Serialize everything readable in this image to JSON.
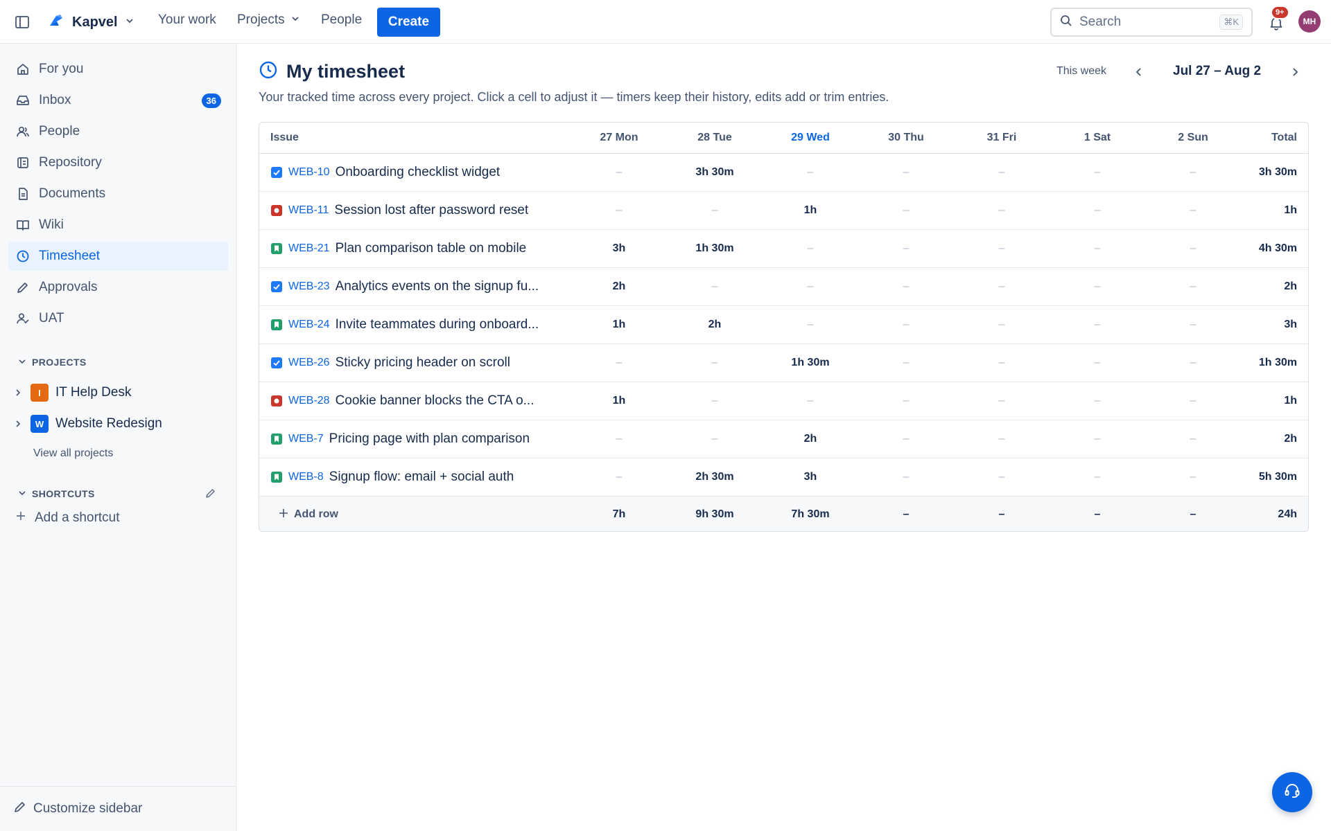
{
  "topbar": {
    "brand_name": "Kapvel",
    "nav_your_work": "Your work",
    "nav_projects": "Projects",
    "nav_people": "People",
    "create_label": "Create",
    "search_placeholder": "Search",
    "search_shortcut": "⌘K",
    "notif_badge": "9+",
    "avatar_initials": "MH"
  },
  "sidebar": {
    "items": [
      {
        "label": "For you",
        "icon": "home-icon"
      },
      {
        "label": "Inbox",
        "icon": "inbox-icon",
        "badge": "36"
      },
      {
        "label": "People",
        "icon": "people-icon"
      },
      {
        "label": "Repository",
        "icon": "repository-icon"
      },
      {
        "label": "Documents",
        "icon": "document-icon"
      },
      {
        "label": "Wiki",
        "icon": "book-icon"
      },
      {
        "label": "Timesheet",
        "icon": "clock-icon",
        "active": true
      },
      {
        "label": "Approvals",
        "icon": "pen-icon"
      },
      {
        "label": "UAT",
        "icon": "user-check-icon"
      }
    ],
    "projects_heading": "PROJECTS",
    "projects": [
      {
        "name": "IT Help Desk",
        "letter": "I",
        "color": "#e56910"
      },
      {
        "name": "Website Redesign",
        "letter": "W",
        "color": "#0c66e4"
      }
    ],
    "view_all": "View all projects",
    "shortcuts_heading": "SHORTCUTS",
    "add_shortcut": "Add a shortcut",
    "customize": "Customize sidebar"
  },
  "page": {
    "title": "My timesheet",
    "subtitle": "Your tracked time across every project. Click a cell to adjust it — timers keep their history, edits add or trim entries.",
    "week_label": "This week",
    "week_range": "Jul 27 – Aug 2"
  },
  "table": {
    "headers": {
      "issue": "Issue",
      "days": [
        "27 Mon",
        "28 Tue",
        "29 Wed",
        "30 Thu",
        "31 Fri",
        "1 Sat",
        "2 Sun"
      ],
      "total": "Total"
    },
    "today_index": 2,
    "rows": [
      {
        "key": "WEB-10",
        "type": "task",
        "summary": "Onboarding checklist widget",
        "cells": [
          "–",
          "3h 30m",
          "–",
          "–",
          "–",
          "–",
          "–"
        ],
        "total": "3h 30m"
      },
      {
        "key": "WEB-11",
        "type": "bug",
        "summary": "Session lost after password reset",
        "cells": [
          "–",
          "–",
          "1h",
          "–",
          "–",
          "–",
          "–"
        ],
        "total": "1h"
      },
      {
        "key": "WEB-21",
        "type": "story",
        "summary": "Plan comparison table on mobile",
        "cells": [
          "3h",
          "1h 30m",
          "–",
          "–",
          "–",
          "–",
          "–"
        ],
        "total": "4h 30m"
      },
      {
        "key": "WEB-23",
        "type": "task",
        "summary": "Analytics events on the signup fu...",
        "cells": [
          "2h",
          "–",
          "–",
          "–",
          "–",
          "–",
          "–"
        ],
        "total": "2h"
      },
      {
        "key": "WEB-24",
        "type": "story",
        "summary": "Invite teammates during onboard...",
        "cells": [
          "1h",
          "2h",
          "–",
          "–",
          "–",
          "–",
          "–"
        ],
        "total": "3h"
      },
      {
        "key": "WEB-26",
        "type": "task",
        "summary": "Sticky pricing header on scroll",
        "cells": [
          "–",
          "–",
          "1h 30m",
          "–",
          "–",
          "–",
          "–"
        ],
        "total": "1h 30m"
      },
      {
        "key": "WEB-28",
        "type": "bug",
        "summary": "Cookie banner blocks the CTA o...",
        "cells": [
          "1h",
          "–",
          "–",
          "–",
          "–",
          "–",
          "–"
        ],
        "total": "1h"
      },
      {
        "key": "WEB-7",
        "type": "story",
        "summary": "Pricing page with plan comparison",
        "cells": [
          "–",
          "–",
          "2h",
          "–",
          "–",
          "–",
          "–"
        ],
        "total": "2h"
      },
      {
        "key": "WEB-8",
        "type": "story",
        "summary": "Signup flow: email + social auth",
        "cells": [
          "–",
          "2h 30m",
          "3h",
          "–",
          "–",
          "–",
          "–"
        ],
        "total": "5h 30m"
      }
    ],
    "footer": {
      "add_row": "Add row",
      "totals": [
        "7h",
        "9h 30m",
        "7h 30m",
        "–",
        "–",
        "–",
        "–"
      ],
      "grand_total": "24h"
    }
  },
  "colors": {
    "accent": "#0c66e4",
    "task": "#1d7afc",
    "bug": "#c9372c",
    "story": "#22a06b"
  }
}
